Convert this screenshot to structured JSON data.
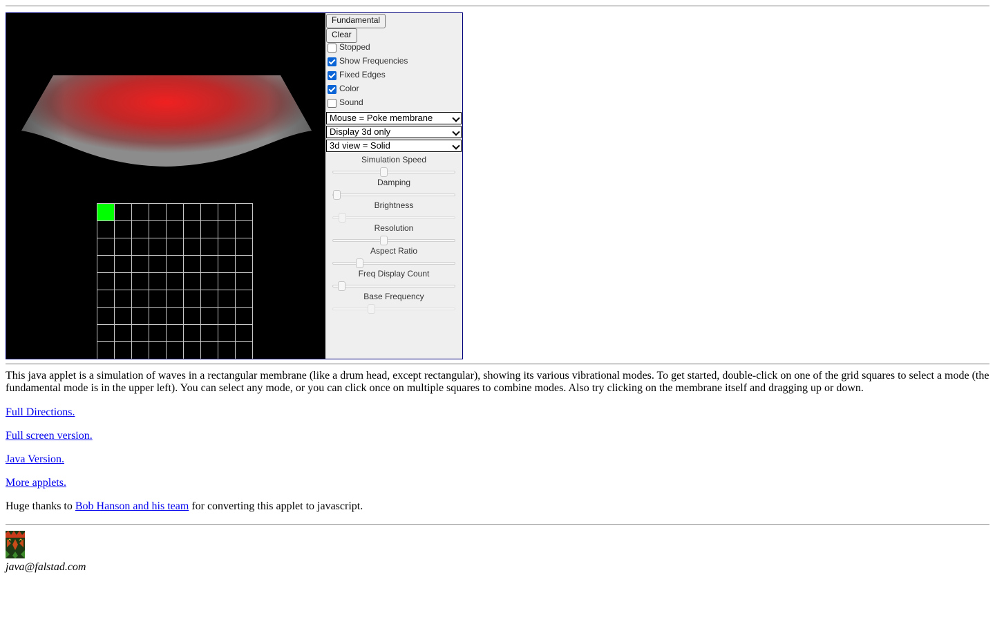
{
  "applet": {
    "controls": {
      "buttons": [
        {
          "label": "Fundamental"
        },
        {
          "label": "Clear"
        }
      ],
      "checkboxes": [
        {
          "label": "Stopped",
          "checked": false
        },
        {
          "label": "Show Frequencies",
          "checked": true
        },
        {
          "label": "Fixed Edges",
          "checked": true
        },
        {
          "label": "Color",
          "checked": true
        },
        {
          "label": "Sound",
          "checked": false
        }
      ],
      "selects": [
        {
          "value": "Mouse = Poke membrane"
        },
        {
          "value": "Display 3d only"
        },
        {
          "value": "3d view = Solid"
        }
      ],
      "sliders": [
        {
          "label": "Simulation Speed",
          "level": 0.41
        },
        {
          "label": "Damping",
          "level": 0.0
        },
        {
          "label": "Brightness",
          "level": 0.05
        },
        {
          "label": "Resolution",
          "level": 0.41
        },
        {
          "label": "Aspect Ratio",
          "level": 0.2
        },
        {
          "label": "Freq Display Count",
          "level": 0.04
        },
        {
          "label": "Base Frequency",
          "level": 0.3
        }
      ]
    },
    "mode_grid": {
      "selected": [
        [
          0,
          0
        ]
      ],
      "selected_color": "#00ff00",
      "line_color": "#c8c8c8"
    },
    "membrane_color": "#e02020"
  },
  "description": "This java applet is a simulation of waves in a rectangular membrane (like a drum head, except rectangular), showing its various vibrational modes. To get started, double-click on one of the grid squares to select a mode (the fundamental mode is in the upper left). You can select any mode, or you can click once on multiple squares to combine modes. Also try clicking on the membrane itself and dragging up or down.",
  "links": {
    "full_directions": "Full Directions.",
    "full_screen": "Full screen version.",
    "java_version": "Java Version.",
    "more_applets": "More applets."
  },
  "thanks": {
    "before": "Huge thanks to ",
    "link": "Bob Hanson and his team",
    "after": " for converting this applet to javascript."
  },
  "footer": {
    "email": "java@falstad.com"
  }
}
